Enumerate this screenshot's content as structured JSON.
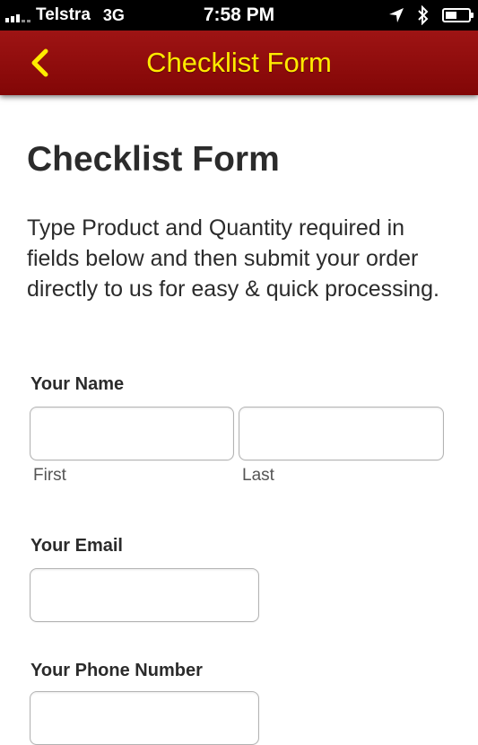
{
  "status_bar": {
    "carrier": "Telstra",
    "network": "3G",
    "time": "7:58 PM"
  },
  "nav": {
    "title": "Checklist Form"
  },
  "page": {
    "title": "Checklist Form",
    "intro": "Type Product and Quantity required in fields below and then submit your order directly to us for easy & quick processing."
  },
  "form": {
    "name_label": "Your Name",
    "first_label": "First",
    "last_label": "Last",
    "email_label": "Your Email",
    "phone_label": "Your Phone Number"
  },
  "colors": {
    "navbar": "#8e0b0b",
    "nav_title": "#ffea00",
    "text": "#2b2b2b"
  }
}
